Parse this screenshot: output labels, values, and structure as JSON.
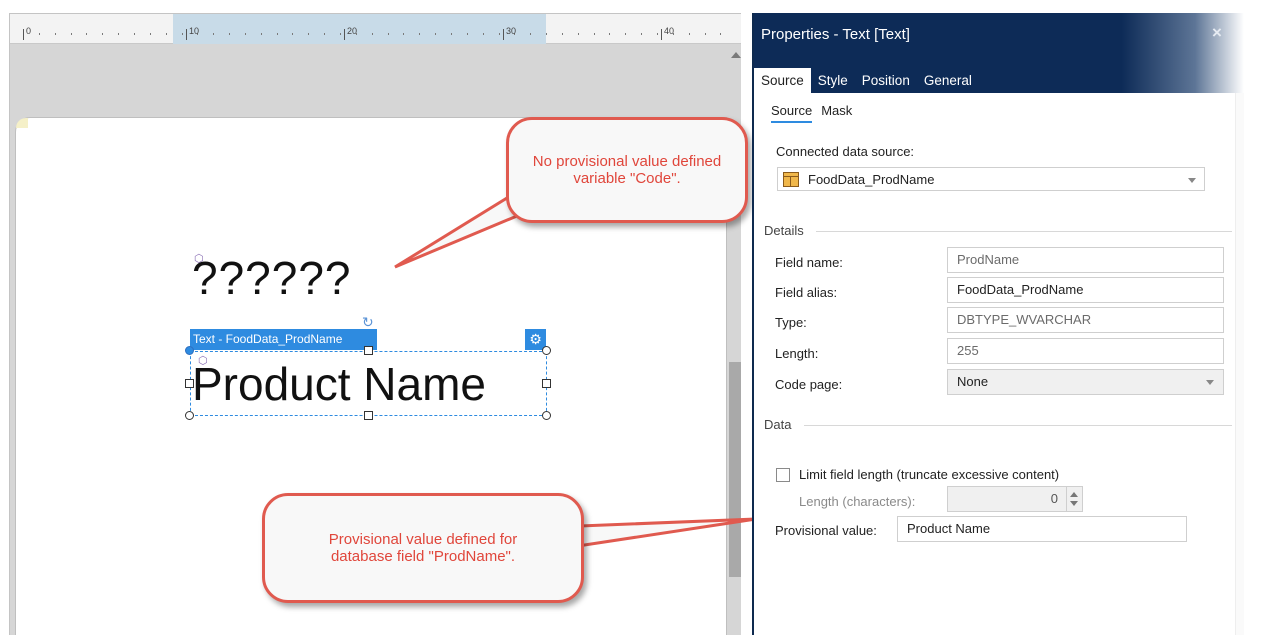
{
  "ruler": {
    "labels": [
      "0",
      "10",
      "20",
      "30",
      "40"
    ]
  },
  "canvas": {
    "placeholder_text": "??????",
    "selection_label": "Text - FoodData_ProdName",
    "selected_text": "Product Name"
  },
  "callouts": {
    "top": "No provisional value defined variable \"Code\".",
    "bottom": "Provisional value defined for database field \"ProdName\"."
  },
  "properties": {
    "title": "Properties - Text [Text]",
    "close_icon": "×",
    "tabs": [
      "Source",
      "Style",
      "Position",
      "General"
    ],
    "subtabs": [
      "Source",
      "Mask"
    ],
    "connected_label": "Connected data source:",
    "connected_value": "FoodData_ProdName",
    "details_header": "Details",
    "fields": [
      {
        "label": "Field name:",
        "value": "ProdName"
      },
      {
        "label": "Field alias:",
        "value": "FoodData_ProdName"
      },
      {
        "label": "Type:",
        "value": "DBTYPE_WVARCHAR"
      },
      {
        "label": "Length:",
        "value": "255"
      },
      {
        "label": "Code page:",
        "value": "None"
      }
    ],
    "data_header": "Data",
    "limit_label": "Limit field length (truncate excessive content)",
    "length_chars_label": "Length (characters):",
    "length_chars_value": "0",
    "provisional_label": "Provisional value:",
    "provisional_value": "Product Name"
  },
  "colors": {
    "panel_header": "#0d2b57",
    "selection": "#2e8be0",
    "callout_border": "#e05a4f",
    "callout_text": "#e0463b"
  }
}
